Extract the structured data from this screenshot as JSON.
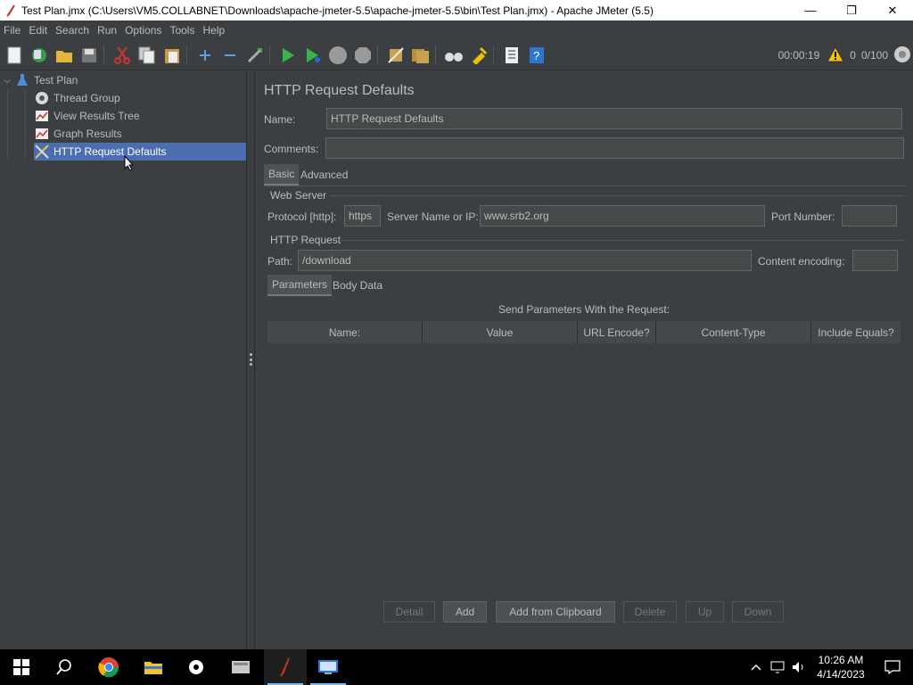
{
  "window": {
    "title": "Test Plan.jmx (C:\\Users\\VM5.COLLABNET\\Downloads\\apache-jmeter-5.5\\apache-jmeter-5.5\\bin\\Test Plan.jmx) - Apache JMeter (5.5)",
    "minimize": "—",
    "maximize": "❐",
    "close": "✕"
  },
  "menu": [
    "File",
    "Edit",
    "Search",
    "Run",
    "Options",
    "Tools",
    "Help"
  ],
  "toolbar_status": {
    "elapsed": "00:00:19",
    "warnings": "0",
    "threads": "0/100"
  },
  "tree": {
    "root": "Test Plan",
    "items": [
      {
        "label": "Thread Group",
        "icon": "gear-icon"
      },
      {
        "label": "View Results Tree",
        "icon": "graph-icon"
      },
      {
        "label": "Graph Results",
        "icon": "graph-icon"
      },
      {
        "label": "HTTP Request Defaults",
        "icon": "wrench-icon",
        "selected": true
      }
    ]
  },
  "panel": {
    "title": "HTTP Request Defaults",
    "name_label": "Name:",
    "name_value": "HTTP Request Defaults",
    "comments_label": "Comments:",
    "comments_value": "",
    "tabs": [
      "Basic",
      "Advanced"
    ],
    "active_tab": "Basic",
    "web_server": {
      "group_title": "Web Server",
      "protocol_label": "Protocol [http]:",
      "protocol_value": "https",
      "server_label": "Server Name or IP:",
      "server_value": "www.srb2.org",
      "port_label": "Port Number:",
      "port_value": ""
    },
    "http_request": {
      "group_title": "HTTP Request",
      "path_label": "Path:",
      "path_value": "/download",
      "encoding_label": "Content encoding:",
      "encoding_value": ""
    },
    "subtabs": [
      "Parameters",
      "Body Data"
    ],
    "active_subtab": "Parameters",
    "table_caption": "Send Parameters With the Request:",
    "table_columns": [
      "Name:",
      "Value",
      "URL Encode?",
      "Content-Type",
      "Include Equals?"
    ],
    "buttons": {
      "detail": "Detail",
      "add": "Add",
      "add_clipboard": "Add from Clipboard",
      "delete": "Delete",
      "up": "Up",
      "down": "Down"
    }
  },
  "taskbar": {
    "time": "10:26 AM",
    "date": "4/14/2023"
  }
}
